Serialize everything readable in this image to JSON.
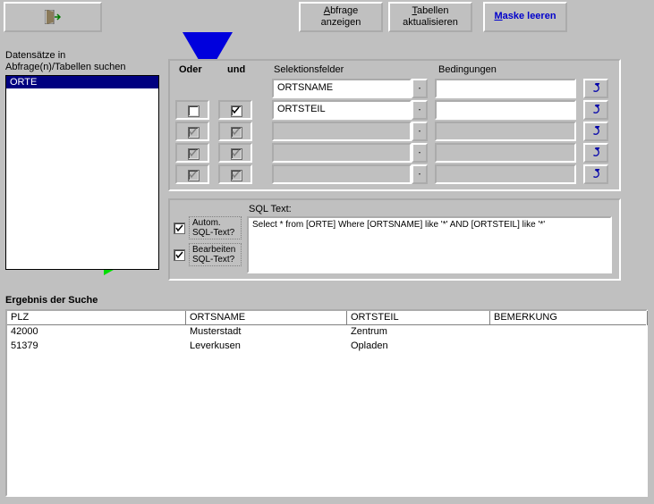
{
  "toolbar": {
    "exit_icon": "exit-door",
    "show_query": "Abfrage anzeigen",
    "refresh_tables": "Tabellen aktualisieren",
    "clear_mask": "Maske leeren"
  },
  "left": {
    "label_line1": "Datensätze in",
    "label_line2": "Abfrage(n)/Tabellen suchen",
    "items": [
      "ORTE"
    ]
  },
  "criteria": {
    "hdr_oder": "Oder",
    "hdr_und": "und",
    "hdr_fields": "Selektionsfelder",
    "hdr_cond": "Bedingungen",
    "rows": [
      {
        "oder": false,
        "und": true,
        "field": "ORTSNAME",
        "cond": "",
        "enabled": true,
        "oder_visible": false,
        "und_visible": false
      },
      {
        "oder": false,
        "und": true,
        "field": "ORTSTEIL",
        "cond": "",
        "enabled": true,
        "oder_visible": true,
        "und_visible": true
      },
      {
        "oder": false,
        "und": false,
        "field": "",
        "cond": "",
        "enabled": false,
        "oder_visible": true,
        "und_visible": true
      },
      {
        "oder": false,
        "und": false,
        "field": "",
        "cond": "",
        "enabled": false,
        "oder_visible": true,
        "und_visible": true
      },
      {
        "oder": false,
        "und": false,
        "field": "",
        "cond": "",
        "enabled": false,
        "oder_visible": true,
        "und_visible": true
      }
    ]
  },
  "sql": {
    "title": "SQL Text:",
    "auto_label": "Autom. SQL-Text?",
    "edit_label": "Bearbeiten SQL-Text?",
    "auto_checked": true,
    "edit_checked": true,
    "text": "Select * from [ORTE] Where [ORTSNAME] like '*' AND [ORTSTEIL] like '*'"
  },
  "result": {
    "title": "Ergebnis der Suche",
    "columns": {
      "plz": "PLZ",
      "ortsname": "ORTSNAME",
      "ortsteil": "ORTSTEIL",
      "bemerkung": "BEMERKUNG"
    },
    "rows": [
      {
        "plz": "42000",
        "ortsname": "Musterstadt",
        "ortsteil": "Zentrum",
        "bemerkung": ""
      },
      {
        "plz": "51379",
        "ortsname": "Leverkusen",
        "ortsteil": "Opladen",
        "bemerkung": ""
      }
    ]
  }
}
